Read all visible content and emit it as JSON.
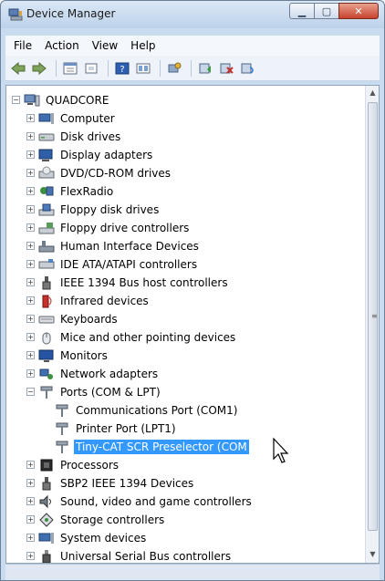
{
  "window": {
    "title": "Device Manager"
  },
  "caption_buttons": {
    "minimize": "▁",
    "maximize": "▢",
    "close": "✕"
  },
  "menu": [
    "File",
    "Action",
    "View",
    "Help"
  ],
  "toolbar": [
    "back-icon",
    "forward-icon",
    "properties-grid-icon",
    "show-hidden-icon",
    "help-icon",
    "view-toggle-icon",
    "scan-hardware-icon",
    "update-driver-icon",
    "disable-device-icon",
    "uninstall-icon"
  ],
  "tree": {
    "root": "QUADCORE",
    "categories": [
      {
        "label": "Computer",
        "icon": "computer-icon"
      },
      {
        "label": "Disk drives",
        "icon": "disk-drive-icon"
      },
      {
        "label": "Display adapters",
        "icon": "display-adapter-icon"
      },
      {
        "label": "DVD/CD-ROM drives",
        "icon": "dvd-drive-icon"
      },
      {
        "label": "FlexRadio",
        "icon": "flexradio-icon"
      },
      {
        "label": "Floppy disk drives",
        "icon": "floppy-drive-icon"
      },
      {
        "label": "Floppy drive controllers",
        "icon": "floppy-controller-icon"
      },
      {
        "label": "Human Interface Devices",
        "icon": "hid-icon"
      },
      {
        "label": "IDE ATA/ATAPI controllers",
        "icon": "ide-controller-icon"
      },
      {
        "label": "IEEE 1394 Bus host controllers",
        "icon": "ieee1394-icon"
      },
      {
        "label": "Infrared devices",
        "icon": "infrared-icon"
      },
      {
        "label": "Keyboards",
        "icon": "keyboard-icon"
      },
      {
        "label": "Mice and other pointing devices",
        "icon": "mouse-icon"
      },
      {
        "label": "Monitors",
        "icon": "monitor-icon"
      },
      {
        "label": "Network adapters",
        "icon": "network-adapter-icon"
      },
      {
        "label": "Ports (COM & LPT)",
        "icon": "port-icon"
      }
    ],
    "ports_children": [
      {
        "label": "Communications Port (COM1)",
        "icon": "port-icon"
      },
      {
        "label": "Printer Port (LPT1)",
        "icon": "port-icon"
      },
      {
        "label": "Tiny-CAT SCR Preselector (COM",
        "icon": "port-icon",
        "selected": true
      }
    ],
    "after": [
      {
        "label": "Processors",
        "icon": "processor-icon"
      },
      {
        "label": "SBP2 IEEE 1394 Devices",
        "icon": "sbp2-icon"
      },
      {
        "label": "Sound, video and game controllers",
        "icon": "sound-icon"
      },
      {
        "label": "Storage controllers",
        "icon": "storage-icon"
      },
      {
        "label": "System devices",
        "icon": "system-devices-icon"
      },
      {
        "label": "Universal Serial Bus controllers",
        "icon": "usb-icon"
      }
    ]
  },
  "expander": {
    "collapsed": "+",
    "expanded": "−"
  },
  "scrollbar": {
    "up": "▲",
    "down": "▼",
    "grip": "≡"
  },
  "colors": {
    "selection": "#3399ff",
    "titlebar": "#c9dcef"
  }
}
